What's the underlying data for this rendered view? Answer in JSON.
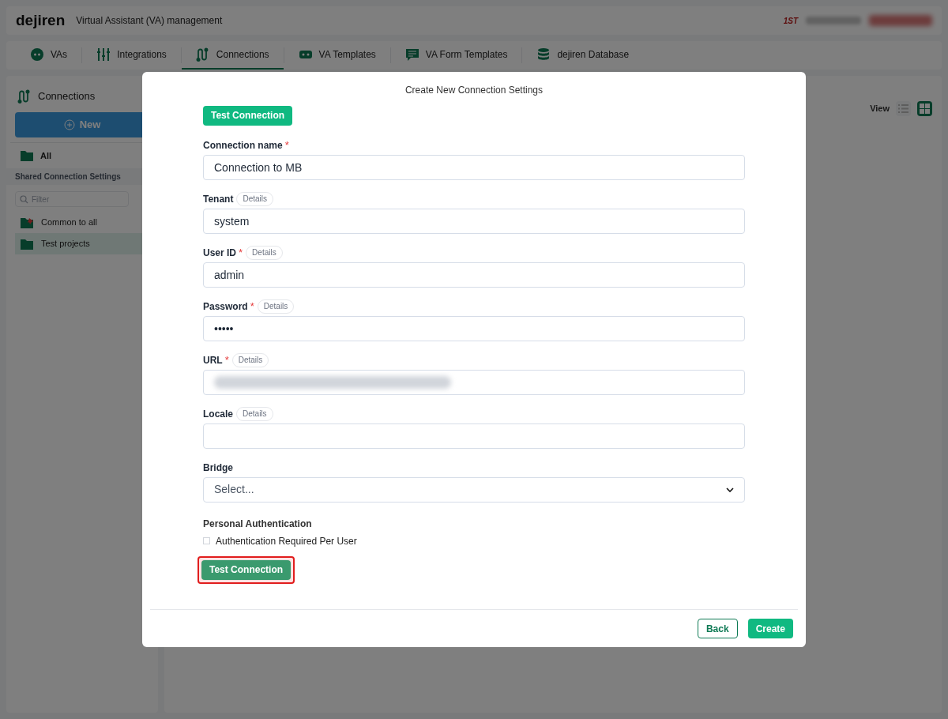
{
  "header": {
    "logo": "dejiren",
    "title": "Virtual Assistant (VA) management",
    "badge": "1ST"
  },
  "tabs": [
    {
      "label": "VAs",
      "selected": false
    },
    {
      "label": "Integrations",
      "selected": false
    },
    {
      "label": "Connections",
      "selected": true
    },
    {
      "label": "VA Templates",
      "selected": false
    },
    {
      "label": "VA Form Templates",
      "selected": false
    },
    {
      "label": "dejiren Database",
      "selected": false
    }
  ],
  "sidebar": {
    "title": "Connections",
    "new_button": "New",
    "all_item": "All",
    "section": "Shared Connection Settings",
    "filter_placeholder": "Filter",
    "items": [
      {
        "label": "Common to all",
        "pinned": true,
        "selected": false
      },
      {
        "label": "Test projects",
        "pinned": false,
        "selected": true
      }
    ]
  },
  "view": {
    "label": "View",
    "modes": [
      {
        "kind": "list",
        "selected": false
      },
      {
        "kind": "grid",
        "selected": true
      }
    ]
  },
  "dialog": {
    "title": "Create New Connection Settings",
    "top_button": "Test Connection",
    "fields": [
      {
        "kind": "text",
        "label": "Connection name",
        "required_mark": "*",
        "value": "Connection to MB"
      },
      {
        "kind": "text",
        "label": "Tenant",
        "details": "Details",
        "value": "system"
      },
      {
        "kind": "text",
        "label": "User ID",
        "required_mark": "*",
        "details": "Details",
        "value": "admin"
      },
      {
        "kind": "password",
        "label": "Password",
        "required_mark": "*",
        "details": "Details",
        "value": "•••••"
      },
      {
        "kind": "redacted",
        "label": "URL",
        "required_mark": "*",
        "details": "Details"
      },
      {
        "kind": "text",
        "label": "Locale",
        "details": "Details"
      },
      {
        "kind": "select",
        "label": "Bridge",
        "placeholder": "Select..."
      }
    ],
    "auth": {
      "heading": "Personal Authentication",
      "label": "Authentication Required Per User",
      "checked": false
    },
    "bottom_button": {
      "label": "Test Connection",
      "highlighted": true
    },
    "back": "Back",
    "create": "Create"
  }
}
